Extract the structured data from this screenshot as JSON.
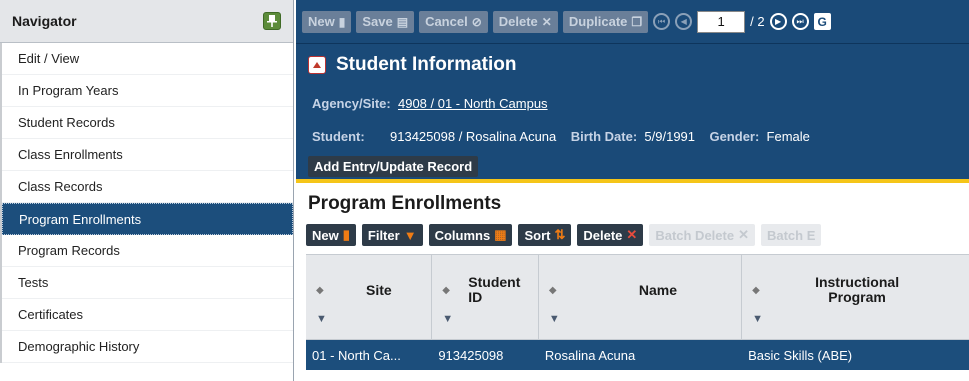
{
  "navigator": {
    "title": "Navigator",
    "items": [
      {
        "label": "Edit / View"
      },
      {
        "label": "In Program Years"
      },
      {
        "label": "Student Records"
      },
      {
        "label": "Class Enrollments"
      },
      {
        "label": "Class Records"
      },
      {
        "label": "Program Enrollments",
        "active": true
      },
      {
        "label": "Program Records"
      },
      {
        "label": "Tests"
      },
      {
        "label": "Certificates"
      },
      {
        "label": "Demographic History"
      }
    ]
  },
  "toolbar": {
    "new": "New",
    "save": "Save",
    "cancel": "Cancel",
    "delete": "Delete",
    "duplicate": "Duplicate",
    "page_value": "1",
    "page_total": "/ 2",
    "go": "G"
  },
  "student_info": {
    "title": "Student Information",
    "agency_label": "Agency/Site:",
    "agency_value": "4908 / 01 - North Campus",
    "student_label": "Student:",
    "student_value": "913425098 / Rosalina Acuna",
    "birth_label": "Birth Date:",
    "birth_value": "5/9/1991",
    "gender_label": "Gender:",
    "gender_value": "Female",
    "add_entry": "Add Entry/Update Record"
  },
  "program_enrollments": {
    "title": "Program Enrollments",
    "toolbar": {
      "new": "New",
      "filter": "Filter",
      "columns": "Columns",
      "sort": "Sort",
      "delete": "Delete",
      "batch_delete": "Batch Delete",
      "batch_edit": "Batch E"
    },
    "columns": [
      {
        "title": "Site"
      },
      {
        "title": "Student ID"
      },
      {
        "title": "Name"
      },
      {
        "title": "Instructional Program"
      }
    ],
    "rows": [
      {
        "site": "01 - North Ca...",
        "student_id": "913425098",
        "name": "Rosalina Acuna",
        "program": "Basic Skills (ABE)"
      }
    ]
  },
  "colors": {
    "header_blue": "#1a4a78",
    "accent_yellow": "#f5c518",
    "selected_row": "#1c4e7c"
  }
}
